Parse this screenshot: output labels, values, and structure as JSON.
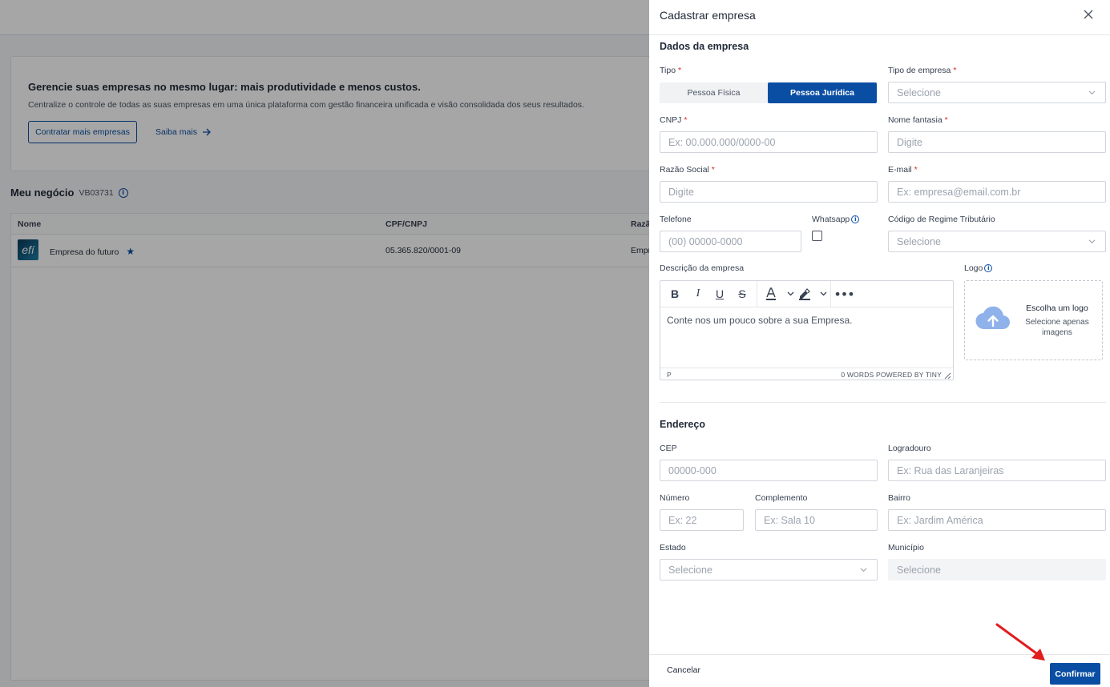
{
  "background": {
    "banner": {
      "title": "Gerencie suas empresas no mesmo lugar: mais produtividade e menos custos.",
      "text": "Centralize o controle de todas as suas empresas em uma única plataforma com gestão financeira unificada e visão consolidada dos seus resultados.",
      "primary_button": "Contratar mais empresas",
      "link": "Saiba mais"
    },
    "section": {
      "title": "Meu negócio",
      "code": "VB03731"
    },
    "table": {
      "headers": [
        "Nome",
        "CPF/CNPJ",
        "Razã"
      ],
      "rows": [
        {
          "logo_text": "efí",
          "name": "Empresa do futuro",
          "cnpj": "05.365.820/0001-09",
          "razao": "Empr"
        }
      ]
    }
  },
  "drawer": {
    "title": "Cadastrar empresa",
    "company_section": "Dados da empresa",
    "tipo": {
      "label": "Tipo",
      "options": [
        "Pessoa Física",
        "Pessoa Jurídica"
      ],
      "selected": "Pessoa Jurídica"
    },
    "tipo_empresa": {
      "label": "Tipo de empresa",
      "placeholder": "Selecione"
    },
    "cnpj": {
      "label": "CNPJ",
      "placeholder": "Ex: 00.000.000/0000-00"
    },
    "nome_fantasia": {
      "label": "Nome fantasia",
      "placeholder": "Digite"
    },
    "razao_social": {
      "label": "Razão Social",
      "placeholder": "Digite"
    },
    "email": {
      "label": "E-mail",
      "placeholder": "Ex: empresa@email.com.br"
    },
    "telefone": {
      "label": "Telefone",
      "placeholder": "(00) 00000-0000"
    },
    "whatsapp": {
      "label": "Whatsapp",
      "checked": false
    },
    "regime": {
      "label": "Código de Regime Tributário",
      "placeholder": "Selecione"
    },
    "descricao": {
      "label": "Descrição da empresa",
      "placeholder": "Conte nos um pouco sobre a sua Empresa.",
      "status_path": "P",
      "status_right": "0 WORDS  POWERED BY TINY"
    },
    "logo": {
      "label": "Logo",
      "title": "Escolha um logo",
      "subtitle": "Selecione apenas imagens"
    },
    "address_section": "Endereço",
    "cep": {
      "label": "CEP",
      "placeholder": "00000-000"
    },
    "logradouro": {
      "label": "Logradouro",
      "placeholder": "Ex: Rua das Laranjeiras"
    },
    "numero": {
      "label": "Número",
      "placeholder": "Ex: 22"
    },
    "complemento": {
      "label": "Complemento",
      "placeholder": "Ex: Sala 10"
    },
    "bairro": {
      "label": "Bairro",
      "placeholder": "Ex: Jardim América"
    },
    "estado": {
      "label": "Estado",
      "placeholder": "Selecione"
    },
    "municipio": {
      "label": "Município",
      "placeholder": "Selecione"
    },
    "footer": {
      "cancel": "Cancelar",
      "confirm": "Confirmar"
    }
  },
  "colors": {
    "primary": "#0a4ea3",
    "required": "#dc2626",
    "annotation_arrow": "#e11d1d"
  },
  "icons": [
    "close-icon",
    "chevron-down-icon",
    "info-icon",
    "star-icon",
    "cloud-upload-icon",
    "arrow-right-icon",
    "bold-icon",
    "italic-icon",
    "underline-icon",
    "strikethrough-icon",
    "text-color-icon",
    "highlight-icon",
    "more-icon"
  ]
}
